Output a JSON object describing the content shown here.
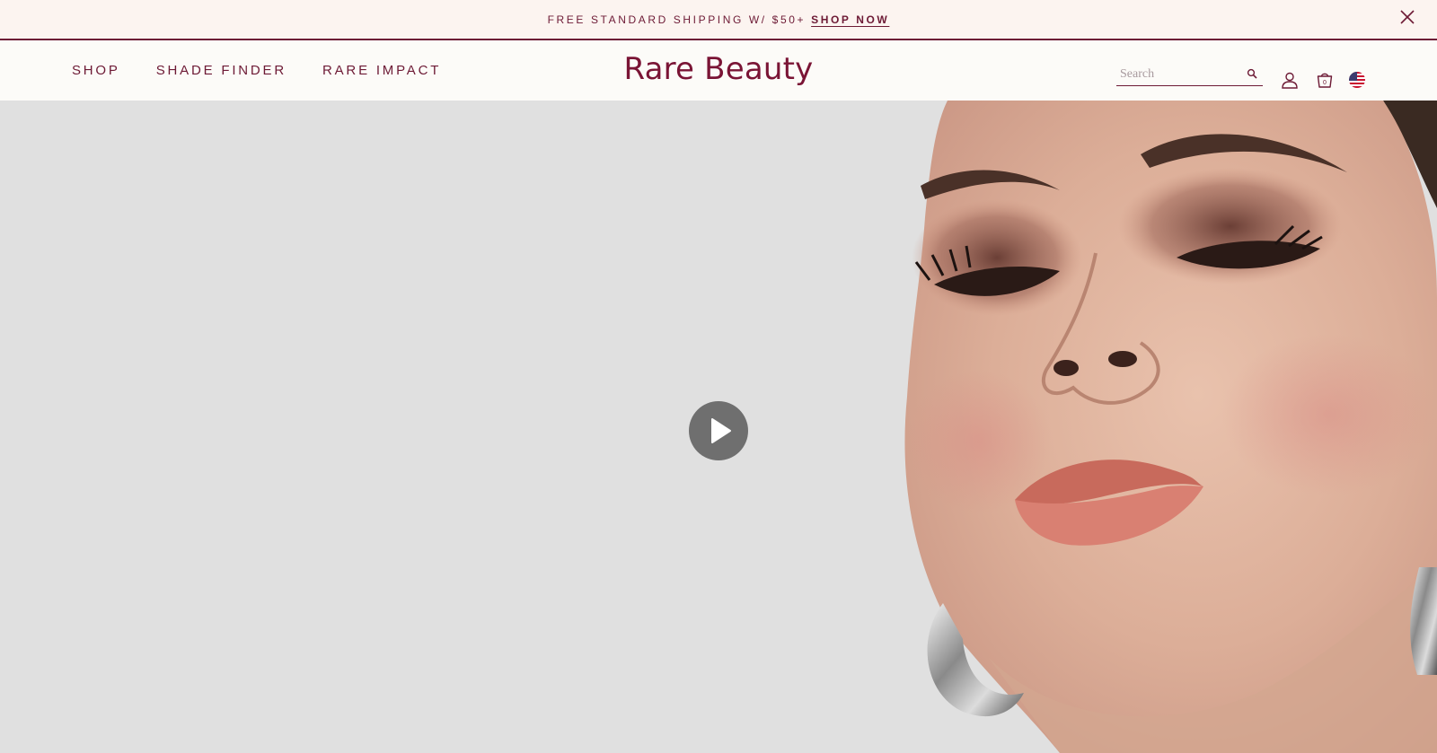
{
  "announcement": {
    "message": "FREE STANDARD SHIPPING W/ $50+",
    "cta": "SHOP NOW",
    "close_icon": "close-icon"
  },
  "header": {
    "nav": [
      {
        "label": "SHOP"
      },
      {
        "label": "SHADE FINDER"
      },
      {
        "label": "RARE IMPACT"
      }
    ],
    "logo": "Rare Beauty",
    "search": {
      "placeholder": "Search",
      "icon": "search-icon"
    },
    "account_icon": "user-icon",
    "cart": {
      "icon": "shopping-bag-icon",
      "count": "0"
    },
    "locale_icon": "us-flag-icon"
  },
  "hero": {
    "image": "model-closeup-photo",
    "play_icon": "play-icon"
  },
  "colors": {
    "brand": "#6d1a35",
    "announce_bg": "#fcf4f0",
    "header_bg": "#fcfbf8",
    "hero_bg": "#e0e0e0"
  }
}
